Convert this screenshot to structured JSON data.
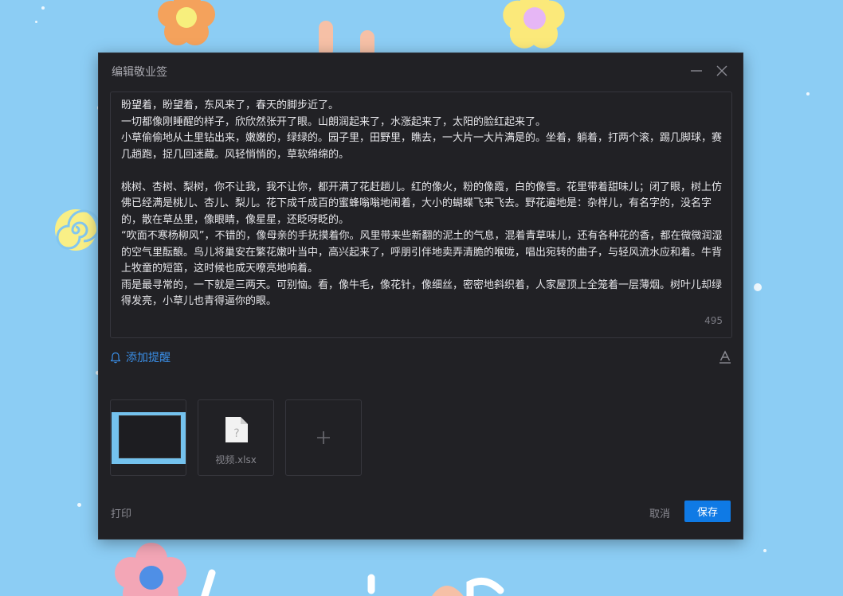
{
  "dialog": {
    "title": "编辑敬业签",
    "icons": {
      "minimize": "minimize-icon",
      "close": "close-icon"
    }
  },
  "editor": {
    "paragraphs": [
      "盼望着，盼望着，东风来了，春天的脚步近了。",
      "一切都像刚睡醒的样子，欣欣然张开了眼。山朗润起来了，水涨起来了，太阳的脸红起来了。",
      "小草偷偷地从土里钻出来，嫩嫩的，绿绿的。园子里，田野里，瞧去，一大片一大片满是的。坐着，躺着，打两个滚，踢几脚球，赛几趟跑，捉几回迷藏。风轻悄悄的，草软绵绵的。",
      "",
      "桃树、杏树、梨树，你不让我，我不让你，都开满了花赶趟儿。红的像火，粉的像霞，白的像雪。花里带着甜味儿；闭了眼，树上仿佛已经满是桃儿、杏儿、梨儿。花下成千成百的蜜蜂嗡嗡地闹着，大小的蝴蝶飞来飞去。野花遍地是：杂样儿，有名字的，没名字的，散在草丛里，像眼睛，像星星，还眨呀眨的。",
      "“吹面不寒杨柳风”，不错的，像母亲的手抚摸着你。风里带来些新翻的泥土的气息，混着青草味儿，还有各种花的香，都在微微润湿的空气里酝酿。鸟儿将巢安在繁花嫩叶当中，高兴起来了，呼朋引伴地卖弄清脆的喉咙，唱出宛转的曲子，与轻风流水应和着。牛背上牧童的短笛，这时候也成天嘹亮地响着。",
      "雨是最寻常的，一下就是三两天。可别恼。看，像牛毛，像花针，像细丝，密密地斜织着，人家屋顶上全笼着一层薄烟。树叶儿却绿得发亮，小草儿也青得逼你的眼。"
    ],
    "char_count": "495"
  },
  "reminder": {
    "label": "添加提醒",
    "icon": "bell-icon"
  },
  "font_icon": "font-format-icon",
  "attachments": [
    {
      "type": "image",
      "icon": "image-thumbnail"
    },
    {
      "type": "file",
      "name": "视频.xlsx",
      "icon": "unknown-file-icon"
    }
  ],
  "add_icon": "plus-icon",
  "footer": {
    "print_label": "打印",
    "cancel_label": "取消",
    "save_label": "保存"
  },
  "colors": {
    "accent": "#0f7ae5",
    "link": "#3a8ee6",
    "dialog_bg": "#212125",
    "desktop_bg": "#8ccdf4"
  }
}
